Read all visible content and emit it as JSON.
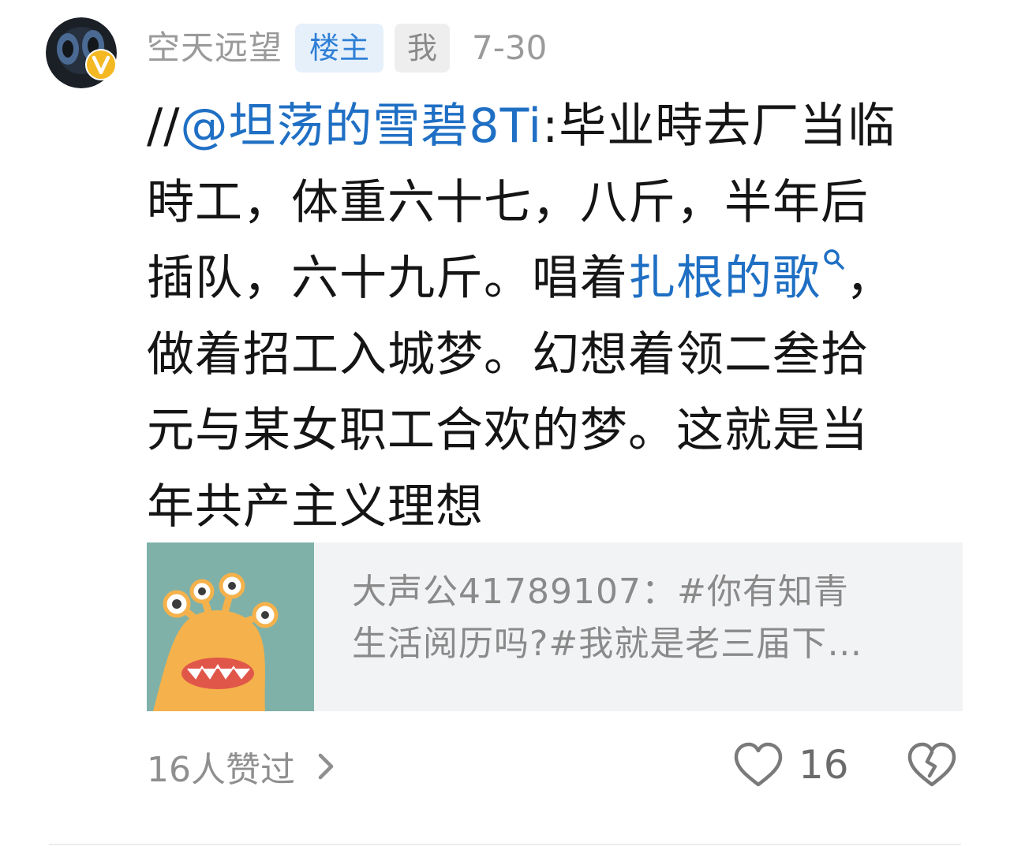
{
  "comment": {
    "username": "空天远望",
    "badge_op": "楼主",
    "badge_me": "我",
    "date": "7-30",
    "body": {
      "line1_prefix": "//",
      "mention": "@坦荡的雪碧8Ti",
      "line1_rest": ":毕业時去厂当临",
      "line2": "時工，体重六十七，八斤，半年后",
      "line3_prefix": "插队，六十九斤。唱着",
      "topic_link": "扎根的歌",
      "line3_suffix": "，",
      "line4": "做着招工入城梦。幻想着领二叁拾",
      "line5": "元与某女职工合欢的梦。这就是当",
      "line6": "年共产主义理想"
    },
    "quote": {
      "line1": "大声公41789107：#你有知青",
      "line2": "生活阅历吗?#我就是老三届下…"
    },
    "footer": {
      "likers_text": "16人赞过",
      "like_count": "16"
    }
  },
  "colors": {
    "link": "#1f6fc4",
    "badge_op_bg": "#e6f0fb",
    "badge_op_text": "#2f7fd6",
    "quote_bg": "#f2f3f5",
    "thumb_bg": "#7fb1a8",
    "monster": "#f5b14b"
  },
  "icons": {
    "avatar_badge": "vip-v-badge",
    "search": "search-icon",
    "chevron": "chevron-right-icon",
    "like": "heart-outline-icon",
    "dislike": "broken-heart-icon"
  }
}
